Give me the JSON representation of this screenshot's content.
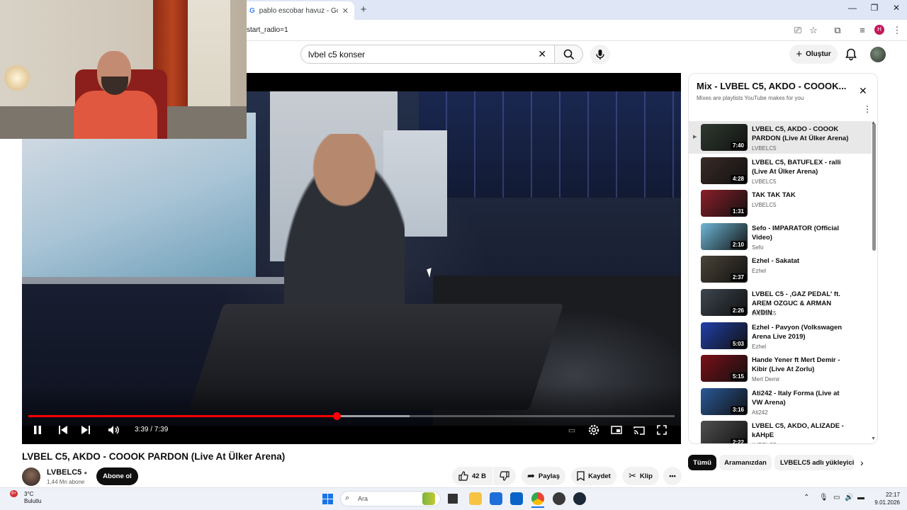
{
  "browser": {
    "tab_title": "pablo escobar havuz - Google'",
    "tab_favicon": "G",
    "tab_close": "✕",
    "new_tab": "+",
    "url": "start_radio=1",
    "profile_letter": "H",
    "window_controls": [
      "—",
      "❐",
      "✕"
    ]
  },
  "youtube": {
    "search_value": "lvbel c5 konser",
    "create_label": "Oluştur"
  },
  "player": {
    "time_text": "3:39 / 7:39",
    "progress_fraction": 0.4771,
    "buffered_fraction": 0.59
  },
  "video": {
    "title": "LVBEL C5, AKDO - COOOK PARDON (Live At Ülker Arena)",
    "channel": "LVBELC5",
    "subscribers": "1,44 Mn abone",
    "subscribe_label": "Abone ol",
    "likes": "42 B",
    "share_label": "Paylaş",
    "save_label": "Kaydet",
    "clip_label": "Klip",
    "more_label": "•••"
  },
  "playlist": {
    "title": "Mix - LVBEL C5, AKDO - COOOK...",
    "subtitle": "Mixes are playlists YouTube makes for you",
    "items": [
      {
        "title": "LVBEL C5, AKDO - COOOK PARDON (Live At Ülker Arena)",
        "channel": "LVBELC5",
        "duration": "7:40",
        "selected": true,
        "thumb": "#2f3a30"
      },
      {
        "title": "LVBEL C5, BATUFLEX - ralli (Live At Ülker Arena)",
        "channel": "LVBELC5",
        "duration": "4:28",
        "selected": false,
        "thumb": "#3a2a26"
      },
      {
        "title": "TAK TAK TAK",
        "channel": "LVBELC5",
        "duration": "1:31",
        "selected": false,
        "thumb": "#8c1f2a"
      },
      {
        "title": "Sefo - IMPARATOR (Official Video)",
        "channel": "Sefo",
        "duration": "2:10",
        "selected": false,
        "thumb": "#6fb8d8"
      },
      {
        "title": "Ezhel - Sakatat",
        "channel": "Ezhel",
        "duration": "2:37",
        "selected": false,
        "thumb": "#4a4438"
      },
      {
        "title": "LVBEL C5 - ‚GAZ PEDAL' ft. AREM OZGUC & ARMAN AYDIN",
        "channel": "LVBELC5",
        "duration": "2:26",
        "selected": false,
        "thumb": "#3d4650"
      },
      {
        "title": "Ezhel - Pavyon (Volkswagen Arena Live 2019)",
        "channel": "Ezhel",
        "duration": "5:03",
        "selected": false,
        "thumb": "#2040a8"
      },
      {
        "title": "Hande Yener ft Mert Demir - Kibir (Live At Zorlu)",
        "channel": "Mert Demir",
        "duration": "5:15",
        "selected": false,
        "thumb": "#7a1018"
      },
      {
        "title": "Ati242 - Italy Forma (Live at VW Arena)",
        "channel": "Ati242",
        "duration": "3:16",
        "selected": false,
        "thumb": "#2a5a9a"
      },
      {
        "title": "LVBEL C5, AKDO, ALIZADE - kAHpE",
        "channel": "LVBELC5",
        "duration": "2:22",
        "selected": false,
        "thumb": "#505050"
      }
    ]
  },
  "chips": [
    "Tümü",
    "Aramanızdan",
    "LVBELC5 adlı yükleyiciden"
  ],
  "taskbar": {
    "temperature": "3°C",
    "condition": "Bulutlu",
    "badge": "9+",
    "search_placeholder": "Ara",
    "time": "22:17",
    "date": "9.01.2026"
  },
  "colors": {
    "accent_red": "#ff0000",
    "subscribe_bg": "#0f0f0f",
    "selected_item_bg": "#e8e8e8"
  }
}
